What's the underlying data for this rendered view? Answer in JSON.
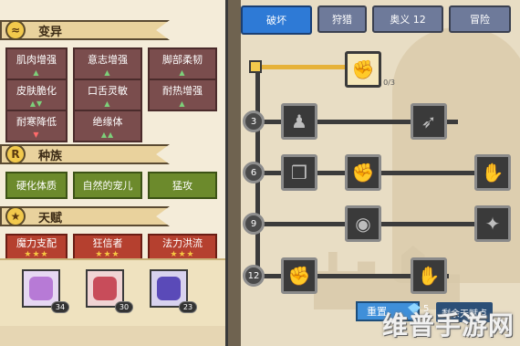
{
  "left_panel": {
    "mutation": {
      "title": "变异",
      "traits": [
        {
          "label": "肌肉增强",
          "tri": "▲"
        },
        {
          "label": "意志增强",
          "tri": "▲"
        },
        {
          "label": "脚部柔韧",
          "tri": "▲"
        },
        {
          "label": "皮肤脆化",
          "tri": "▲▼"
        },
        {
          "label": "口舌灵敏",
          "tri": "▲"
        },
        {
          "label": "耐热增强",
          "tri": "▲"
        },
        {
          "label": "耐寒降低",
          "tri": "▼"
        },
        {
          "label": "绝缘体",
          "tri": "▲▲"
        }
      ]
    },
    "race": {
      "title": "种族",
      "traits": [
        "硬化体质",
        "自然的宠儿",
        "猛攻"
      ]
    },
    "talent": {
      "title": "天赋",
      "traits": [
        {
          "label": "魔力支配",
          "stars": "★★★"
        },
        {
          "label": "狂信者",
          "stars": "★★★"
        },
        {
          "label": "法力洪流",
          "stars": "★★★"
        }
      ]
    },
    "companions": [
      {
        "level": "34"
      },
      {
        "level": "30"
      },
      {
        "level": "23"
      }
    ]
  },
  "right_panel": {
    "tabs": [
      "破坏",
      "狩猎",
      "奥义 12",
      "冒险"
    ],
    "top_node_count": "0/3",
    "rows": [
      "3",
      "6",
      "9",
      "12"
    ],
    "reset_label": "重置",
    "gem_count": "5",
    "remain_label": "剩余天赋点"
  },
  "watermark": "维普手游网",
  "colors": {
    "tab_active": "#2e7ad6",
    "tab_inactive": "#6e7a9a",
    "trait_red": "#7a4d4d",
    "trait_green": "#6c8a2c"
  }
}
